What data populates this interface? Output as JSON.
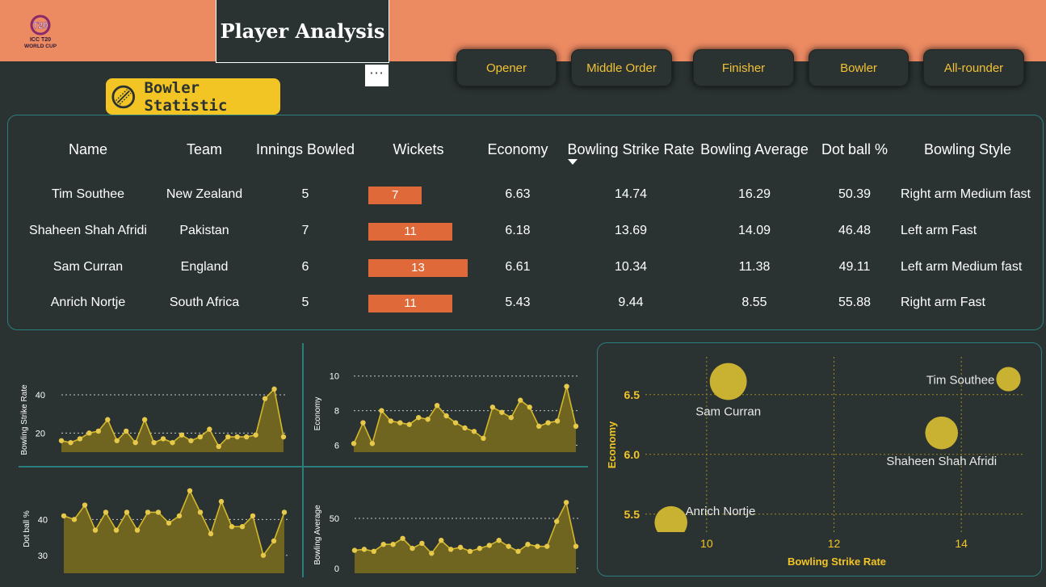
{
  "header": {
    "title": "Player Analysis",
    "logo_text": "ICC T20 WORLD CUP",
    "more_label": "···"
  },
  "nav": {
    "buttons": [
      "Opener",
      "Middle Order",
      "Finisher",
      "Bowler",
      "All-rounder"
    ]
  },
  "section": {
    "badge_label": "Bowler Statistic",
    "badge_icon": "cricket-ball-icon"
  },
  "colors": {
    "header_bg": "#ec8a62",
    "page_bg": "#2b3232",
    "accent_yellow": "#f2c525",
    "bar_orange": "#e0693a",
    "border_teal": "#2c7d7d",
    "chart_fill": "#6f6520",
    "chart_line": "#d4b72b"
  },
  "table": {
    "columns": [
      "Name",
      "Team",
      "Innings Bowled",
      "Wickets",
      "Economy",
      "Bowling Strike Rate",
      "Bowling Average",
      "Dot ball %",
      "Bowling Style"
    ],
    "sorted_column": "Bowling Strike Rate",
    "sort_direction": "descending",
    "wickets_scale_max": 13,
    "rows": [
      {
        "name": "Tim Southee",
        "team": "New Zealand",
        "innings": "5",
        "wickets": "7",
        "economy": "6.63",
        "bsr": "14.74",
        "bavg": "16.29",
        "dot": "50.39",
        "style": "Right arm Medium fast"
      },
      {
        "name": "Shaheen Shah Afridi",
        "team": "Pakistan",
        "innings": "7",
        "wickets": "11",
        "economy": "6.18",
        "bsr": "13.69",
        "bavg": "14.09",
        "dot": "46.48",
        "style": "Left arm Fast"
      },
      {
        "name": "Sam Curran",
        "team": "England",
        "innings": "6",
        "wickets": "13",
        "economy": "6.61",
        "bsr": "10.34",
        "bavg": "11.38",
        "dot": "49.11",
        "style": "Left arm Medium fast"
      },
      {
        "name": "Anrich Nortje",
        "team": "South Africa",
        "innings": "5",
        "wickets": "11",
        "economy": "5.43",
        "bsr": "9.44",
        "bavg": "8.55",
        "dot": "55.88",
        "style": "Right arm Fast"
      }
    ]
  },
  "chart_data": [
    {
      "type": "area",
      "ylabel": "Bowling Strike Rate",
      "yticks": [
        20,
        40
      ],
      "ylim": [
        10,
        48
      ],
      "grid": "dotted horizontal",
      "values": [
        16,
        15,
        17,
        20,
        21,
        27,
        16,
        21,
        15,
        27,
        15,
        17,
        15,
        19,
        16,
        18,
        22,
        13,
        18,
        18,
        18,
        19,
        38,
        43,
        18
      ]
    },
    {
      "type": "area",
      "ylabel": "Economy",
      "yticks": [
        6,
        8,
        10
      ],
      "ylim": [
        5.6,
        10.5
      ],
      "grid": "dotted horizontal",
      "values": [
        6.1,
        7.3,
        6.1,
        8.0,
        7.4,
        7.3,
        7.2,
        7.6,
        7.5,
        8.3,
        7.7,
        7.3,
        7.0,
        6.8,
        6.4,
        8.2,
        7.9,
        7.6,
        8.6,
        8.2,
        7.1,
        7.3,
        7.4,
        9.4,
        7.1
      ]
    },
    {
      "type": "area",
      "ylabel": "Dot ball %",
      "yticks": [
        30,
        40
      ],
      "ylim": [
        25,
        52
      ],
      "grid": "dotted horizontal",
      "values": [
        41,
        40,
        44,
        37,
        42,
        37,
        42,
        37,
        42,
        42,
        39,
        41,
        48,
        42,
        36,
        45,
        38,
        38,
        41,
        30,
        34,
        42
      ]
    },
    {
      "type": "area",
      "ylabel": "Bowling Average",
      "yticks": [
        0,
        50
      ],
      "ylim": [
        -5,
        80
      ],
      "grid": "dotted horizontal",
      "values": [
        18,
        19,
        17,
        24,
        24,
        30,
        20,
        25,
        15,
        28,
        19,
        21,
        17,
        20,
        23,
        28,
        22,
        17,
        24,
        22,
        22,
        47,
        66,
        22
      ]
    },
    {
      "type": "scatter",
      "xlabel": "Bowling Strike Rate",
      "ylabel": "Economy",
      "xticks": [
        10,
        12,
        14
      ],
      "yticks": [
        5.5,
        6.0,
        6.5
      ],
      "xlim": [
        9.0,
        15.0
      ],
      "ylim": [
        5.35,
        6.85
      ],
      "size_field": "Wickets",
      "points": [
        {
          "label": "Sam Curran",
          "x": 10.34,
          "y": 6.61,
          "size": 13
        },
        {
          "label": "Tim Southee",
          "x": 14.74,
          "y": 6.63,
          "size": 7
        },
        {
          "label": "Shaheen Shah Afridi",
          "x": 13.69,
          "y": 6.18,
          "size": 11
        },
        {
          "label": "Anrich Nortje",
          "x": 9.44,
          "y": 5.43,
          "size": 11
        }
      ]
    }
  ]
}
